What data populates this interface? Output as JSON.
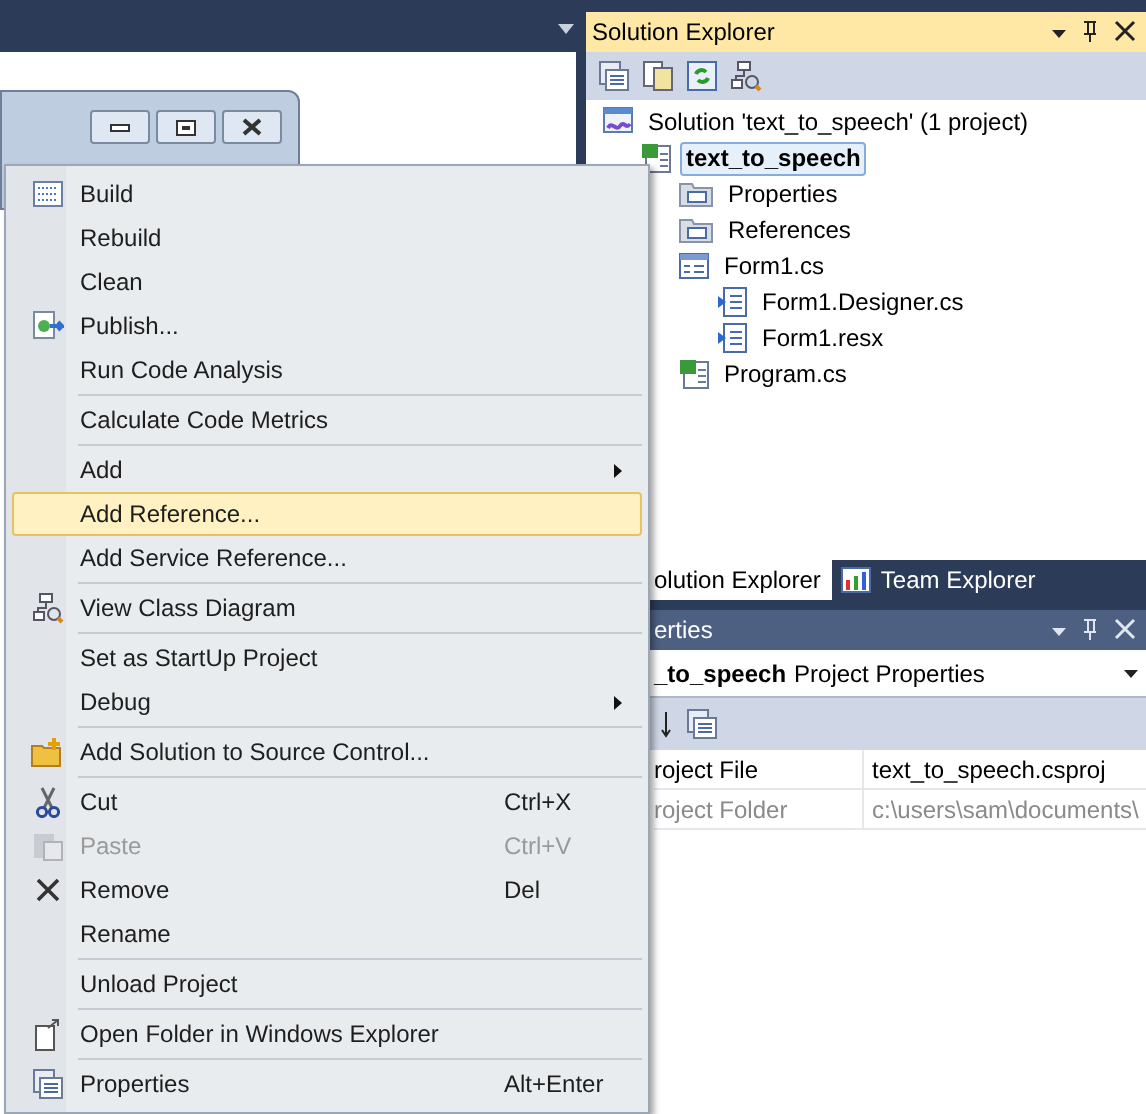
{
  "solution_explorer": {
    "title": "Solution Explorer",
    "tree": [
      {
        "label": "Solution 'text_to_speech' (1 project)",
        "kind": "solution",
        "selected": false,
        "children": [
          {
            "label": "text_to_speech",
            "kind": "project",
            "selected": true,
            "children": [
              {
                "label": "Properties",
                "kind": "properties",
                "selected": false
              },
              {
                "label": "References",
                "kind": "references",
                "selected": false
              },
              {
                "label": "Form1.cs",
                "kind": "form",
                "selected": false,
                "children": [
                  {
                    "label": "Form1.Designer.cs",
                    "kind": "file",
                    "selected": false
                  },
                  {
                    "label": "Form1.resx",
                    "kind": "file",
                    "selected": false
                  }
                ]
              },
              {
                "label": "Program.cs",
                "kind": "csharp",
                "selected": false
              }
            ]
          }
        ]
      }
    ]
  },
  "tabs": [
    {
      "label": "olution Explorer",
      "selected": true
    },
    {
      "label": "Team Explorer",
      "selected": false
    }
  ],
  "properties": {
    "title": "erties",
    "object_name": "_to_speech",
    "object_type": "Project Properties",
    "rows": [
      {
        "name": "roject File",
        "value": "text_to_speech.csproj",
        "disabled": false
      },
      {
        "name": "roject Folder",
        "value": "c:\\users\\sam\\documents\\",
        "disabled": true
      }
    ]
  },
  "context_menu": [
    {
      "label": "Build",
      "selected": false,
      "disabled": false
    },
    {
      "label": "Rebuild",
      "selected": false,
      "disabled": false
    },
    {
      "label": "Clean",
      "selected": false,
      "disabled": false
    },
    {
      "label": "Publish...",
      "selected": false,
      "disabled": false
    },
    {
      "label": "Run Code Analysis",
      "selected": false,
      "disabled": false,
      "separator_after": true
    },
    {
      "label": "Calculate Code Metrics",
      "selected": false,
      "disabled": false,
      "separator_after": true
    },
    {
      "label": "Add",
      "selected": false,
      "disabled": false,
      "submenu": true
    },
    {
      "label": "Add Reference...",
      "selected": true,
      "disabled": false
    },
    {
      "label": "Add Service Reference...",
      "selected": false,
      "disabled": false,
      "separator_after": true
    },
    {
      "label": "View Class Diagram",
      "selected": false,
      "disabled": false,
      "separator_after": true
    },
    {
      "label": "Set as StartUp Project",
      "selected": false,
      "disabled": false
    },
    {
      "label": "Debug",
      "selected": false,
      "disabled": false,
      "submenu": true,
      "separator_after": true
    },
    {
      "label": "Add Solution to Source Control...",
      "selected": false,
      "disabled": false,
      "separator_after": true
    },
    {
      "label": "Cut",
      "shortcut": "Ctrl+X",
      "selected": false,
      "disabled": false
    },
    {
      "label": "Paste",
      "shortcut": "Ctrl+V",
      "selected": false,
      "disabled": true
    },
    {
      "label": "Remove",
      "shortcut": "Del",
      "selected": false,
      "disabled": false
    },
    {
      "label": "Rename",
      "selected": false,
      "disabled": false,
      "separator_after": true
    },
    {
      "label": "Unload Project",
      "selected": false,
      "disabled": false,
      "separator_after": true
    },
    {
      "label": "Open Folder in Windows Explorer",
      "selected": false,
      "disabled": false,
      "separator_after": true
    },
    {
      "label": "Properties",
      "shortcut": "Alt+Enter",
      "selected": false,
      "disabled": false
    }
  ]
}
